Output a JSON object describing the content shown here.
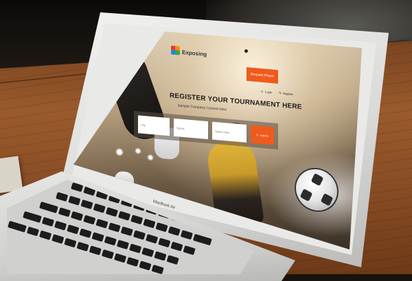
{
  "device": {
    "model_label": "MacBook Air"
  },
  "site": {
    "logo_text": "Exposing",
    "logo_sub": "",
    "cta_button": "Request Player",
    "nav": [
      {
        "label": "Login",
        "icon": "user-icon"
      },
      {
        "label": "Register",
        "icon": "pencil-icon"
      }
    ],
    "hero_title": "REGISTER YOUR TOURNAMENT HERE",
    "hero_subtitle": "Sample Company Content Here",
    "search_form": {
      "fields": [
        {
          "placeholder": "City"
        },
        {
          "placeholder": "Sports"
        },
        {
          "placeholder": "Select Date"
        }
      ],
      "submit_label": "Submit",
      "submit_icon": "search-icon"
    }
  },
  "colors": {
    "accent": "#f05a1c",
    "logo_red": "#e53935",
    "logo_green": "#43a047",
    "logo_blue": "#1e88e5",
    "logo_orange": "#fb8c00"
  }
}
